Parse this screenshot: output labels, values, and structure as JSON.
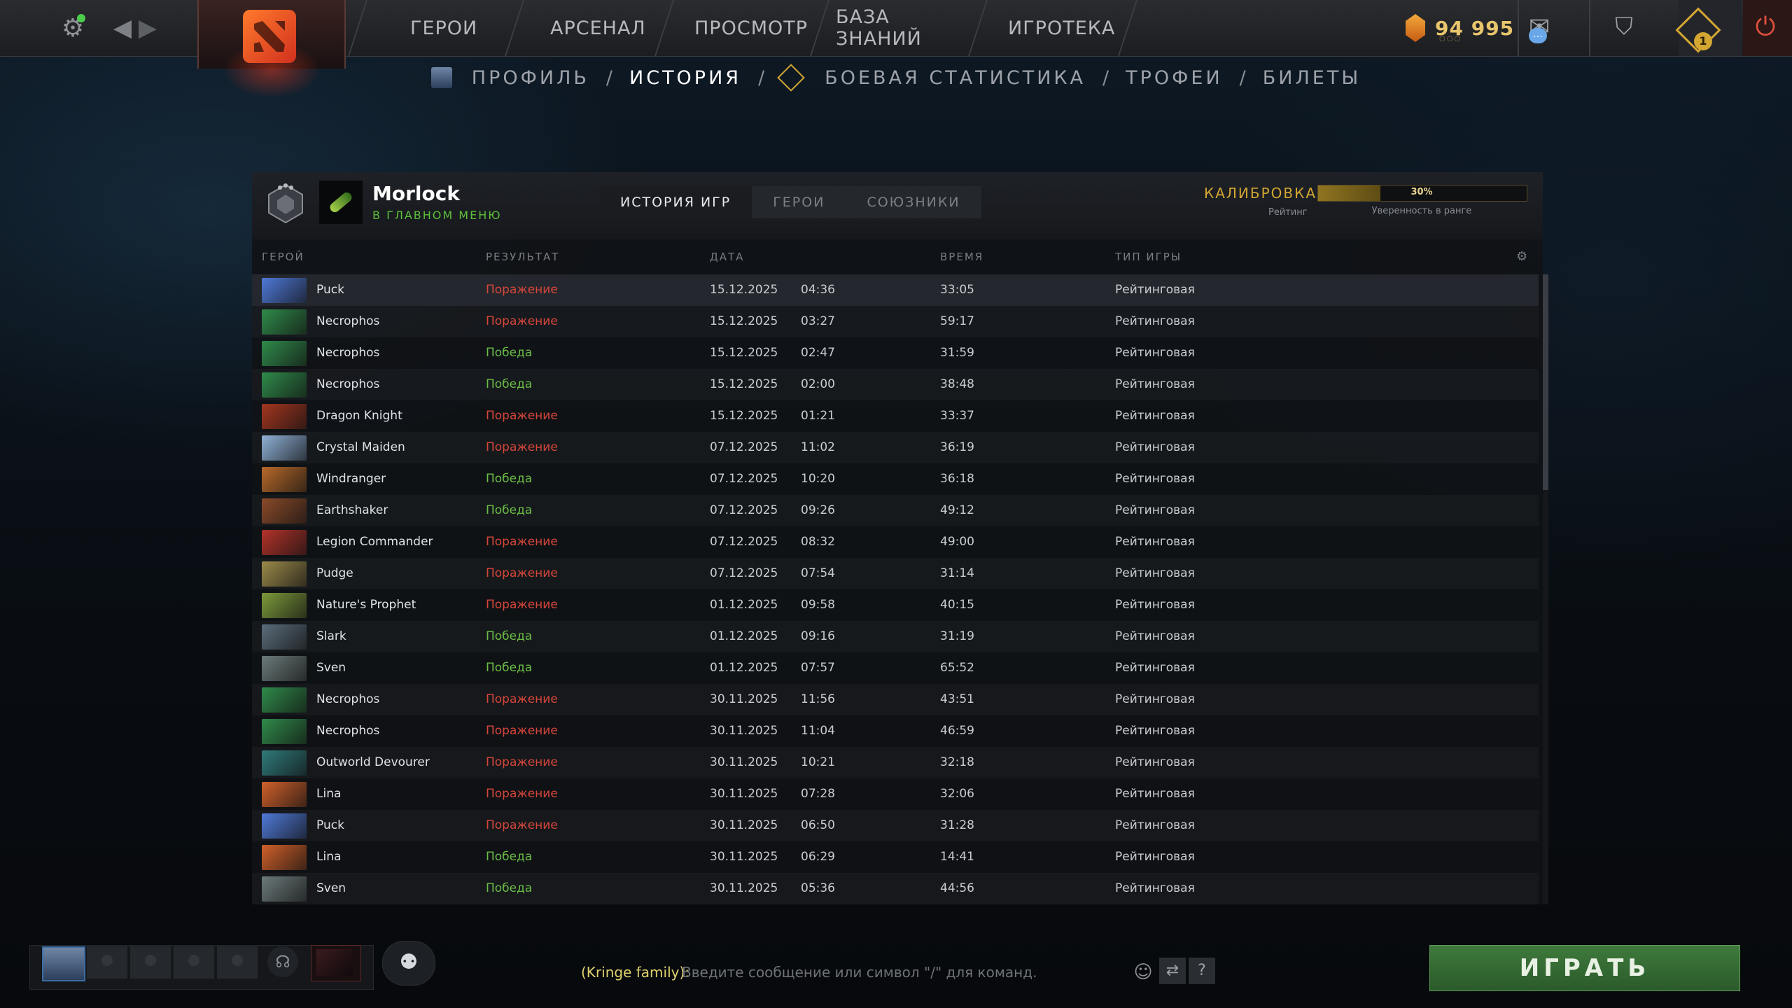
{
  "topbar": {
    "nav": [
      "ГЕРОИ",
      "АРСЕНАЛ",
      "ПРОСМОТР",
      "БАЗА ЗНАНИЙ",
      "ИГРОТЕКА"
    ],
    "currency": "94 995",
    "plus_badge": "1"
  },
  "subnav": {
    "profile": "ПРОФИЛЬ",
    "history": "ИСТОРИЯ",
    "stats": "БОЕВАЯ СТАТИСТИКА",
    "trophies": "ТРОФЕИ",
    "tickets": "БИЛЕТЫ"
  },
  "player": {
    "name": "Morlock",
    "status": "В ГЛАВНОМ МЕНЮ"
  },
  "tabs": [
    "ИСТОРИЯ ИГР",
    "ГЕРОИ",
    "СОЮЗНИКИ"
  ],
  "calibration": {
    "label": "КАЛИБРОВКА",
    "sub": "Рейтинг",
    "confidence": 30,
    "confidence_text": "30%",
    "confidence_caption": "Уверенность в ранге"
  },
  "table": {
    "headers": [
      "ГЕРОЙ",
      "РЕЗУЛЬТАТ",
      "ДАТА",
      "ВРЕМЯ",
      "ТИП ИГРЫ"
    ],
    "rows": [
      {
        "hero": "Puck",
        "result": "Поражение",
        "win": false,
        "date": "15.12.2025",
        "time": "04:36",
        "duration": "33:05",
        "type": "Рейтинговая",
        "color": "#4f79d8"
      },
      {
        "hero": "Necrophos",
        "result": "Поражение",
        "win": false,
        "date": "15.12.2025",
        "time": "03:27",
        "duration": "59:17",
        "type": "Рейтинговая",
        "color": "#2f8a4a"
      },
      {
        "hero": "Necrophos",
        "result": "Победа",
        "win": true,
        "date": "15.12.2025",
        "time": "02:47",
        "duration": "31:59",
        "type": "Рейтинговая",
        "color": "#2f8a4a"
      },
      {
        "hero": "Necrophos",
        "result": "Победа",
        "win": true,
        "date": "15.12.2025",
        "time": "02:00",
        "duration": "38:48",
        "type": "Рейтинговая",
        "color": "#2f8a4a"
      },
      {
        "hero": "Dragon Knight",
        "result": "Поражение",
        "win": false,
        "date": "15.12.2025",
        "time": "01:21",
        "duration": "33:37",
        "type": "Рейтинговая",
        "color": "#a3361f"
      },
      {
        "hero": "Crystal Maiden",
        "result": "Поражение",
        "win": false,
        "date": "07.12.2025",
        "time": "11:02",
        "duration": "36:19",
        "type": "Рейтинговая",
        "color": "#8fb0d6"
      },
      {
        "hero": "Windranger",
        "result": "Победа",
        "win": true,
        "date": "07.12.2025",
        "time": "10:20",
        "duration": "36:18",
        "type": "Рейтинговая",
        "color": "#b7692a"
      },
      {
        "hero": "Earthshaker",
        "result": "Победа",
        "win": true,
        "date": "07.12.2025",
        "time": "09:26",
        "duration": "49:12",
        "type": "Рейтинговая",
        "color": "#8a4a2a"
      },
      {
        "hero": "Legion Commander",
        "result": "Поражение",
        "win": false,
        "date": "07.12.2025",
        "time": "08:32",
        "duration": "49:00",
        "type": "Рейтинговая",
        "color": "#b2322a"
      },
      {
        "hero": "Pudge",
        "result": "Поражение",
        "win": false,
        "date": "07.12.2025",
        "time": "07:54",
        "duration": "31:14",
        "type": "Рейтинговая",
        "color": "#9b8a4a"
      },
      {
        "hero": "Nature's Prophet",
        "result": "Поражение",
        "win": false,
        "date": "01.12.2025",
        "time": "09:58",
        "duration": "40:15",
        "type": "Рейтинговая",
        "color": "#7c9a3a"
      },
      {
        "hero": "Slark",
        "result": "Победа",
        "win": true,
        "date": "01.12.2025",
        "time": "09:16",
        "duration": "31:19",
        "type": "Рейтинговая",
        "color": "#5a6c7a"
      },
      {
        "hero": "Sven",
        "result": "Победа",
        "win": true,
        "date": "01.12.2025",
        "time": "07:57",
        "duration": "65:52",
        "type": "Рейтинговая",
        "color": "#6c7a7a"
      },
      {
        "hero": "Necrophos",
        "result": "Поражение",
        "win": false,
        "date": "30.11.2025",
        "time": "11:56",
        "duration": "43:51",
        "type": "Рейтинговая",
        "color": "#2f8a4a"
      },
      {
        "hero": "Necrophos",
        "result": "Поражение",
        "win": false,
        "date": "30.11.2025",
        "time": "11:04",
        "duration": "46:59",
        "type": "Рейтинговая",
        "color": "#2f8a4a"
      },
      {
        "hero": "Outworld Devourer",
        "result": "Поражение",
        "win": false,
        "date": "30.11.2025",
        "time": "10:21",
        "duration": "32:18",
        "type": "Рейтинговая",
        "color": "#2f7a7a"
      },
      {
        "hero": "Lina",
        "result": "Поражение",
        "win": false,
        "date": "30.11.2025",
        "time": "07:28",
        "duration": "32:06",
        "type": "Рейтинговая",
        "color": "#d0602a"
      },
      {
        "hero": "Puck",
        "result": "Поражение",
        "win": false,
        "date": "30.11.2025",
        "time": "06:50",
        "duration": "31:28",
        "type": "Рейтинговая",
        "color": "#4f79d8"
      },
      {
        "hero": "Lina",
        "result": "Победа",
        "win": true,
        "date": "30.11.2025",
        "time": "06:29",
        "duration": "14:41",
        "type": "Рейтинговая",
        "color": "#d0602a"
      },
      {
        "hero": "Sven",
        "result": "Победа",
        "win": true,
        "date": "30.11.2025",
        "time": "05:36",
        "duration": "44:56",
        "type": "Рейтинговая",
        "color": "#6c7a7a"
      }
    ]
  },
  "chat": {
    "channel": "(Kringe family):",
    "placeholder": "Введите сообщение или символ \"/\" для команд."
  },
  "play_label": "ИГРАТЬ"
}
